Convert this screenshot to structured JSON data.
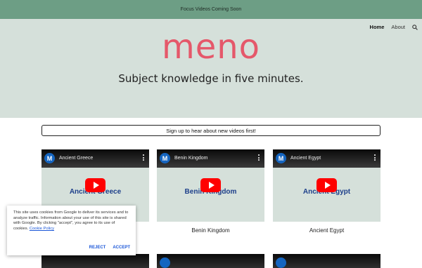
{
  "banner": {
    "text": "Focus Videos Coming Soon"
  },
  "nav": {
    "items": [
      {
        "label": "Home"
      },
      {
        "label": "About"
      }
    ]
  },
  "hero": {
    "logo": "meno",
    "tagline": "Subject knowledge in five minutes."
  },
  "signup": {
    "label": "Sign up to hear about new videos first!"
  },
  "videos": [
    {
      "channel_initial": "M",
      "title": "Ancient Greece",
      "thumb_text": "Ancient Greece",
      "caption": ""
    },
    {
      "channel_initial": "M",
      "title": "Benin Kingdom",
      "thumb_text": "Benin Kingdom",
      "caption": "Benin Kingdom"
    },
    {
      "channel_initial": "M",
      "title": "Ancient Egypt",
      "thumb_text": "Ancient Egypt",
      "caption": "Ancient Egypt"
    }
  ],
  "cookie": {
    "text": "This site uses cookies from Google to deliver its services and to analyze traffic. Information about your use of this site is shared with Google. By clicking \"accept\", you agree to its use of cookies.",
    "link": "Cookie Policy",
    "reject": "REJECT",
    "accept": "ACCEPT"
  },
  "colors": {
    "banner": "#6d9e85",
    "hero": "#d5e0da",
    "logo": "#e5586a",
    "play": "#ff0000",
    "thumb_text": "#1d3f8a"
  }
}
